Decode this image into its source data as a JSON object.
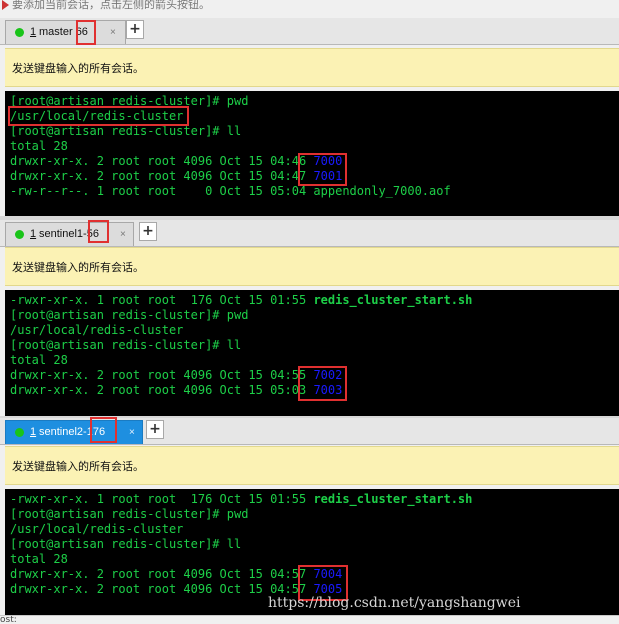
{
  "top_hint": "要添加当前会话，点击左侧的箭头按钮。",
  "panes": [
    {
      "tab": {
        "number": "1",
        "name": "master",
        "suffix": "66",
        "close": "×",
        "active": false
      },
      "add_tab": "+",
      "send_bar": "发送键盘输入的所有会话。",
      "lines": [
        "[root@artisan redis-cluster]# pwd",
        "/usr/local/redis-cluster",
        "[root@artisan redis-cluster]# ll",
        "total 28",
        {
          "prefix": "drwxr-xr-x. 2 root root 4096 Oct 15 04:46 ",
          "dir": "7000"
        },
        {
          "prefix": "drwxr-xr-x. 2 root root 4096 Oct 15 04:47 ",
          "dir": "7001"
        },
        "-rw-r--r--. 1 root root    0 Oct 15 05:04 appendonly_7000.aof"
      ]
    },
    {
      "tab": {
        "number": "1",
        "name": "sentinel1-",
        "suffix": "56",
        "close": "×",
        "active": false
      },
      "add_tab": "+",
      "send_bar": "发送键盘输入的所有会话。",
      "lines": [
        {
          "prefix": "-rwxr-xr-x. 1 root root  176 Oct 15 01:55 ",
          "bold": "redis_cluster_start.sh"
        },
        "[root@artisan redis-cluster]# pwd",
        "/usr/local/redis-cluster",
        "[root@artisan redis-cluster]# ll",
        "total 28",
        {
          "prefix": "drwxr-xr-x. 2 root root 4096 Oct 15 04:55 ",
          "dir": "7002"
        },
        {
          "prefix": "drwxr-xr-x. 2 root root 4096 Oct 15 05:03 ",
          "dir": "7003"
        }
      ]
    },
    {
      "tab": {
        "number": "1",
        "name": "sentinel2-",
        "suffix": "176",
        "close": "×",
        "active": true
      },
      "add_tab": "+",
      "send_bar": "发送键盘输入的所有会话。",
      "lines": [
        {
          "prefix": "-rwxr-xr-x. 1 root root  176 Oct 15 01:55 ",
          "bold": "redis_cluster_start.sh"
        },
        "[root@artisan redis-cluster]# pwd",
        "/usr/local/redis-cluster",
        "[root@artisan redis-cluster]# ll",
        "total 28",
        {
          "prefix": "drwxr-xr-x. 2 root root 4096 Oct 15 04:57 ",
          "dir": "7004"
        },
        {
          "prefix": "drwxr-xr-x. 2 root root 4096 Oct 15 04:57 ",
          "dir": "7005"
        }
      ]
    }
  ],
  "watermark": "https://blog.csdn.net/yangshangwei",
  "status": "ost:",
  "colors": {
    "terminal_bg": "#000000",
    "terminal_fg": "#1dcf48",
    "dir": "#1a1aff",
    "highlight": "#e03030",
    "send_bar": "#fbf2b4",
    "active_tab": "#1e8fe0"
  }
}
